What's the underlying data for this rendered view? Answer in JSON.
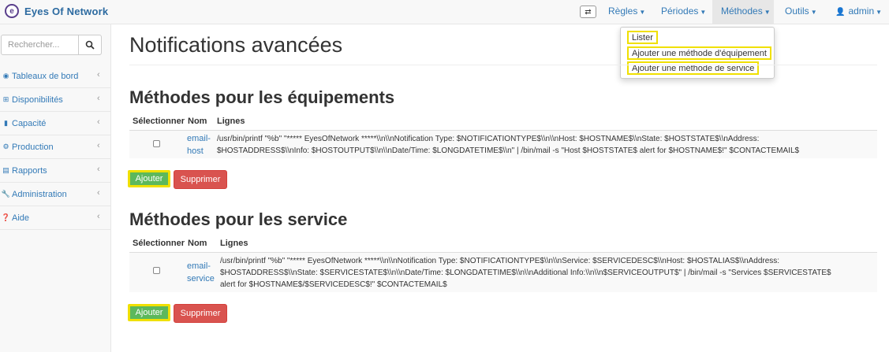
{
  "brand": {
    "name": "Eyes Of Network"
  },
  "nav": {
    "regles": "Règles",
    "periodes": "Périodes",
    "methodes": "Méthodes",
    "outils": "Outils",
    "admin": "admin"
  },
  "dropdown": {
    "items": [
      "Lister",
      "Ajouter une méthode d'équipement",
      "Ajouter une méthode de service"
    ]
  },
  "sidebar": {
    "search_placeholder": "Rechercher...",
    "items": [
      {
        "label": "Tableaux de bord",
        "icon": "dashboard-icon"
      },
      {
        "label": "Disponibilités",
        "icon": "sitemap-icon"
      },
      {
        "label": "Capacité",
        "icon": "bar-chart-icon"
      },
      {
        "label": "Production",
        "icon": "gears-icon"
      },
      {
        "label": "Rapports",
        "icon": "file-icon"
      },
      {
        "label": "Administration",
        "icon": "wrench-icon"
      },
      {
        "label": "Aide",
        "icon": "question-icon"
      }
    ]
  },
  "main": {
    "title": "Notifications avancées",
    "host_section": {
      "title": "Méthodes pour les équipements",
      "headers": {
        "select": "Sélectionner",
        "name": "Nom",
        "lines": "Lignes"
      },
      "row": {
        "name_line1": "email-",
        "name_line2": "host",
        "lines_1": "/usr/bin/printf \"%b\" \"***** EyesOfNetwork *****\\\\n\\\\nNotification Type: $NOTIFICATIONTYPE$\\\\n\\\\nHost: $HOSTNAME$\\\\nState: $HOSTSTATE$\\\\nAddress:",
        "lines_2": "$HOSTADDRESS$\\\\nInfo: $HOSTOUTPUT$\\\\n\\\\nDate/Time: $LONGDATETIME$\\\\n\" | /bin/mail -s \"Host $HOSTSTATE$ alert for $HOSTNAME$!\" $CONTACTEMAIL$"
      },
      "add_label": "Ajouter",
      "delete_label": "Supprimer"
    },
    "service_section": {
      "title": "Méthodes pour les service",
      "headers": {
        "select": "Sélectionner",
        "name": "Nom",
        "lines": "Lignes"
      },
      "row": {
        "name_line1": "email-",
        "name_line2": "service",
        "lines_1": "/usr/bin/printf \"%b\" \"***** EyesOfNetwork *****\\\\n\\\\nNotification Type: $NOTIFICATIONTYPE$\\\\n\\\\nService: $SERVICEDESC$\\\\nHost: $HOSTALIAS$\\\\nAddress:",
        "lines_2": "$HOSTADDRESS$\\\\nState: $SERVICESTATE$\\\\n\\\\nDate/Time: $LONGDATETIME$\\\\n\\\\nAdditional Info:\\\\n\\\\n$SERVICEOUTPUT$\" | /bin/mail -s \"Services $SERVICESTATE$",
        "lines_3": "alert for $HOSTNAME$/$SERVICEDESC$!\" $CONTACTEMAIL$"
      },
      "add_label": "Ajouter",
      "delete_label": "Supprimer"
    }
  }
}
